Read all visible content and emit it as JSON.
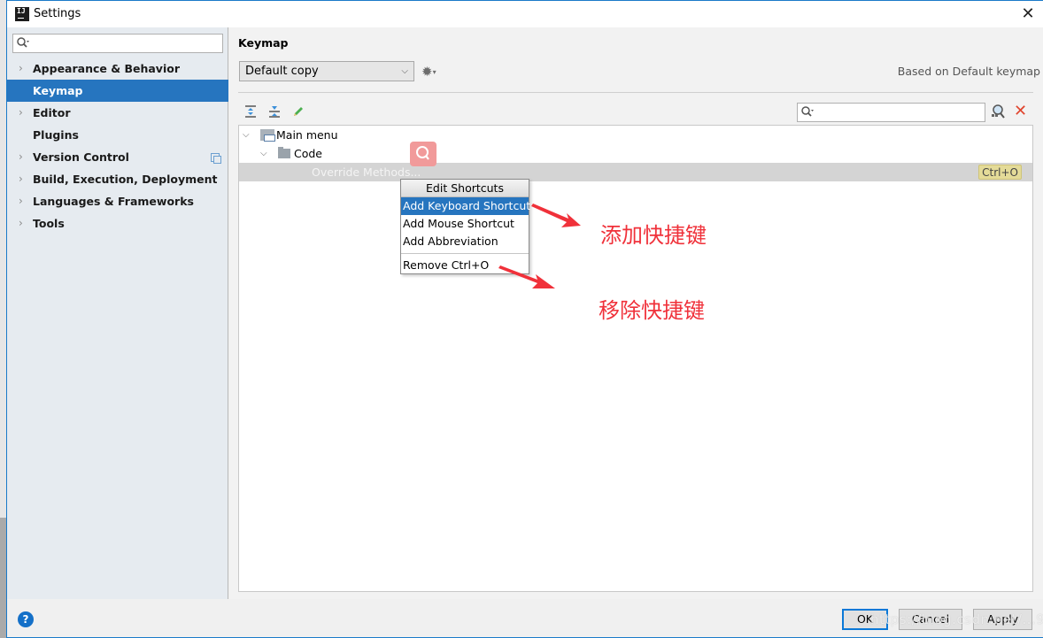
{
  "window": {
    "title": "Settings",
    "app_icon": "intellij-logo-icon",
    "app_icon_text": "IJ",
    "close_symbol": "✕"
  },
  "sidebar": {
    "search_placeholder": "",
    "items": [
      {
        "label": "Appearance & Behavior",
        "expandable": true,
        "selected": false
      },
      {
        "label": "Keymap",
        "expandable": false,
        "selected": true
      },
      {
        "label": "Editor",
        "expandable": true,
        "selected": false
      },
      {
        "label": "Plugins",
        "expandable": false,
        "selected": false
      },
      {
        "label": "Version Control",
        "expandable": true,
        "selected": false,
        "project_icon": true
      },
      {
        "label": "Build, Execution, Deployment",
        "expandable": true,
        "selected": false
      },
      {
        "label": "Languages & Frameworks",
        "expandable": true,
        "selected": false
      },
      {
        "label": "Tools",
        "expandable": true,
        "selected": false
      }
    ],
    "chevron": "›"
  },
  "main": {
    "title": "Keymap",
    "keymap_select": {
      "value": "Default copy",
      "caret": "⌵"
    },
    "gear_symbol": "✹",
    "gear_caret": "▾",
    "based_on": "Based on Default keymap",
    "filter_placeholder": "",
    "tree": {
      "rows": [
        {
          "label": "Main menu",
          "expanded": true,
          "level": 0
        },
        {
          "label": "Code",
          "expanded": true,
          "level": 1
        },
        {
          "label": "Override Methods...",
          "level": 2,
          "selected": true,
          "shortcut": "Ctrl+O"
        }
      ],
      "chevron_expanded": "⌵"
    }
  },
  "context_menu": {
    "header": "Edit Shortcuts",
    "items": [
      {
        "label": "Add Keyboard Shortcut",
        "highlighted": true
      },
      {
        "label": "Add Mouse Shortcut",
        "highlighted": false
      },
      {
        "label": "Add Abbreviation",
        "highlighted": false
      },
      {
        "label": "Remove Ctrl+O",
        "highlighted": false,
        "separator_before": true
      }
    ]
  },
  "annotations": {
    "add_shortcut": "添加快捷键",
    "remove_shortcut": "移除快捷键",
    "color": "#f0313a"
  },
  "footer": {
    "help": "?",
    "ok": "OK",
    "cancel": "Cancel",
    "apply": "Apply",
    "watermark": "https://blog.csdn.net/...9s"
  },
  "colors": {
    "accent": "#2675bf",
    "sidebar_bg": "#e6ebf0",
    "shortcut_badge": "#e4db98",
    "clear_red": "#e0452e"
  }
}
